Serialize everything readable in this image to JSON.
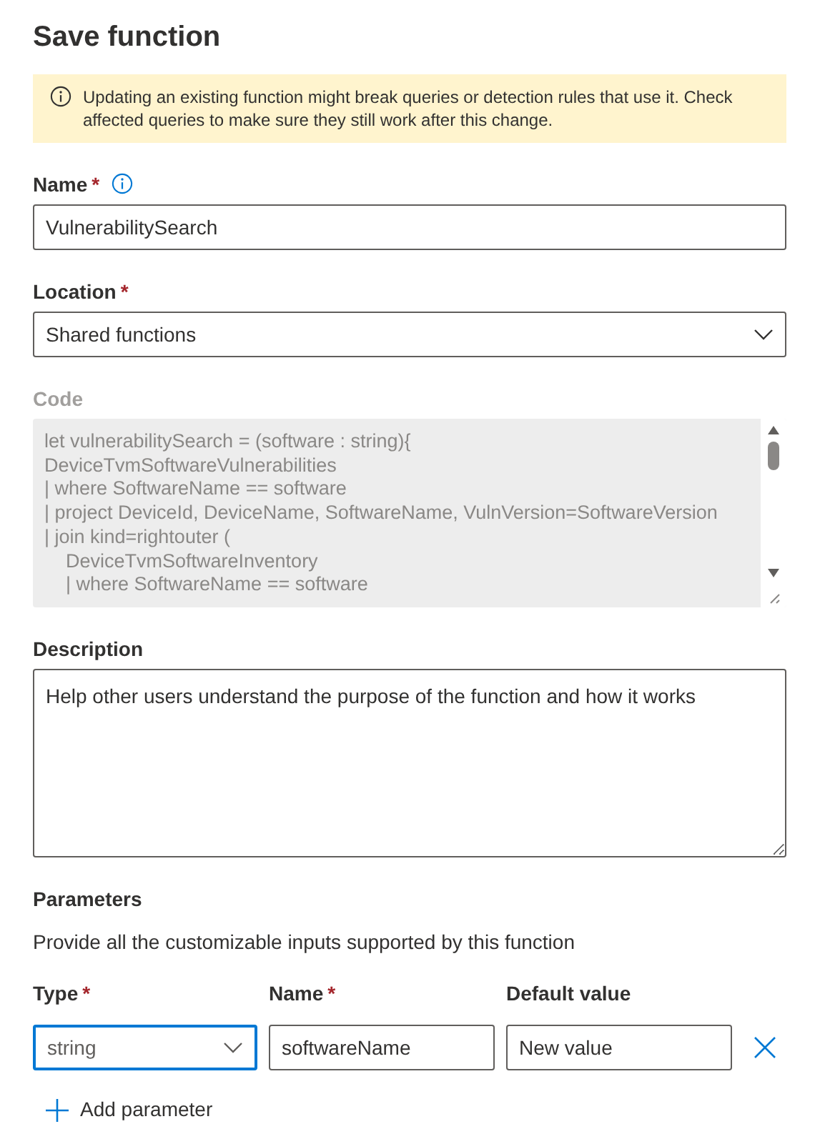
{
  "title": "Save function",
  "warning": {
    "text": "Updating an existing function might break queries or detection rules that use it. Check affected queries to make sure they still work after this change."
  },
  "name_field": {
    "label": "Name",
    "required_mark": "*",
    "value": "VulnerabilitySearch"
  },
  "location_field": {
    "label": "Location",
    "required_mark": "*",
    "value": "Shared functions"
  },
  "code_field": {
    "label": "Code",
    "disabled": true,
    "lines": [
      {
        "text": "let vulnerabilitySearch = (software : string){",
        "indented": false
      },
      {
        "text": "DeviceTvmSoftwareVulnerabilities",
        "indented": false
      },
      {
        "text": "| where SoftwareName == software",
        "indented": false
      },
      {
        "text": "| project DeviceId, DeviceName, SoftwareName, VulnVersion=SoftwareVersion",
        "indented": false
      },
      {
        "text": "| join kind=rightouter (",
        "indented": false
      },
      {
        "text": "DeviceTvmSoftwareInventory",
        "indented": true
      },
      {
        "text": "| where SoftwareName == software",
        "indented": true
      }
    ]
  },
  "description_field": {
    "label": "Description",
    "placeholder": "Help other users understand the purpose of the function and how it works"
  },
  "parameters": {
    "heading": "Parameters",
    "hint": "Provide all the customizable inputs supported by this function",
    "columns": [
      {
        "label": "Type",
        "required_mark": "*"
      },
      {
        "label": "Name",
        "required_mark": "*"
      },
      {
        "label": "Default value"
      }
    ],
    "rows": [
      {
        "type": "string",
        "type_focused": true,
        "name": "softwareName",
        "default": "New value"
      }
    ],
    "add_label": "Add parameter"
  }
}
